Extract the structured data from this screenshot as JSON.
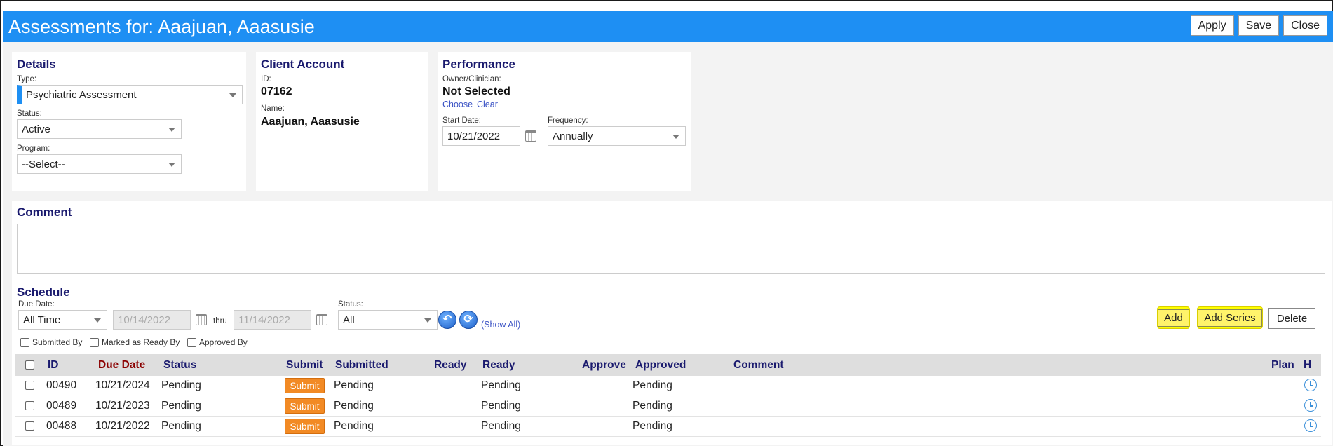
{
  "window": {
    "title": "Assessments for: Aaajuan, Aaasusie",
    "actions": {
      "apply": "Apply",
      "save": "Save",
      "close": "Close"
    }
  },
  "details": {
    "heading": "Details",
    "type_label": "Type:",
    "type_value": "Psychiatric Assessment",
    "status_label": "Status:",
    "status_value": "Active",
    "program_label": "Program:",
    "program_value": "--Select--"
  },
  "client_account": {
    "heading": "Client Account",
    "id_label": "ID:",
    "id_value": "07162",
    "name_label": "Name:",
    "name_value": "Aaajuan, Aaasusie"
  },
  "performance": {
    "heading": "Performance",
    "owner_label": "Owner/Clinician:",
    "owner_value": "Not Selected",
    "choose_link": "Choose",
    "clear_link": "Clear",
    "start_date_label": "Start Date:",
    "start_date_value": "10/21/2022",
    "frequency_label": "Frequency:",
    "frequency_value": "Annually"
  },
  "comment": {
    "heading": "Comment",
    "value": ""
  },
  "schedule": {
    "heading": "Schedule",
    "due_date_label": "Due Date:",
    "due_date_value": "All Time",
    "from_date": "10/14/2022",
    "thru_label": "thru",
    "to_date": "11/14/2022",
    "status_label": "Status:",
    "status_value": "All",
    "show_all_link": "(Show All)",
    "filters": {
      "submitted_by": "Submitted By",
      "marked_ready_by": "Marked as Ready By",
      "approved_by": "Approved By"
    },
    "buttons": {
      "add": "Add",
      "add_series": "Add Series",
      "delete": "Delete"
    },
    "columns": {
      "id": "ID",
      "due_date": "Due Date",
      "status": "Status",
      "submit": "Submit",
      "submitted": "Submitted",
      "ready_action": "Ready",
      "ready": "Ready",
      "approve": "Approve",
      "approved": "Approved",
      "comment": "Comment",
      "plan": "Plan",
      "h": "H"
    },
    "rows": [
      {
        "id": "00490",
        "due_date": "10/21/2024",
        "status": "Pending",
        "submit_label": "Submit",
        "submitted": "Pending",
        "ready": "Pending",
        "approved": "Pending"
      },
      {
        "id": "00489",
        "due_date": "10/21/2023",
        "status": "Pending",
        "submit_label": "Submit",
        "submitted": "Pending",
        "ready": "Pending",
        "approved": "Pending"
      },
      {
        "id": "00488",
        "due_date": "10/21/2022",
        "status": "Pending",
        "submit_label": "Submit",
        "submitted": "Pending",
        "ready": "Pending",
        "approved": "Pending"
      }
    ]
  },
  "colors": {
    "titlebar": "#1e8ff3",
    "heading": "#1a1a6e",
    "due_date_header": "#8b0000",
    "submit_button": "#f28a24",
    "highlight": "#ffff00"
  }
}
